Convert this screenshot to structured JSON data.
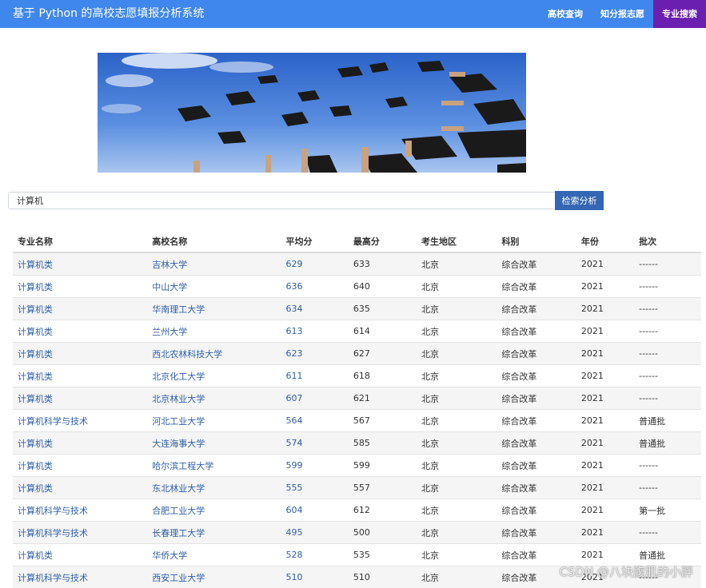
{
  "header": {
    "title": "基于 Python 的高校志愿填报分析系统",
    "nav": [
      {
        "label": "高校查询",
        "active": false
      },
      {
        "label": "知分报志愿",
        "active": false
      },
      {
        "label": "专业搜索",
        "active": true
      }
    ]
  },
  "search": {
    "value": "计算机",
    "button_label": "检索分析"
  },
  "table": {
    "columns": [
      "专业名称",
      "高校名称",
      "平均分",
      "最高分",
      "考生地区",
      "科别",
      "年份",
      "批次"
    ],
    "rows": [
      [
        "计算机类",
        "吉林大学",
        "629",
        "633",
        "北京",
        "综合改革",
        "2021",
        "------"
      ],
      [
        "计算机类",
        "中山大学",
        "636",
        "640",
        "北京",
        "综合改革",
        "2021",
        "------"
      ],
      [
        "计算机类",
        "华南理工大学",
        "634",
        "635",
        "北京",
        "综合改革",
        "2021",
        "------"
      ],
      [
        "计算机类",
        "兰州大学",
        "613",
        "614",
        "北京",
        "综合改革",
        "2021",
        "------"
      ],
      [
        "计算机类",
        "西北农林科技大学",
        "623",
        "627",
        "北京",
        "综合改革",
        "2021",
        "------"
      ],
      [
        "计算机类",
        "北京化工大学",
        "611",
        "618",
        "北京",
        "综合改革",
        "2021",
        "------"
      ],
      [
        "计算机类",
        "北京林业大学",
        "607",
        "621",
        "北京",
        "综合改革",
        "2021",
        "------"
      ],
      [
        "计算机科学与技术",
        "河北工业大学",
        "564",
        "567",
        "北京",
        "综合改革",
        "2021",
        "普通批"
      ],
      [
        "计算机类",
        "大连海事大学",
        "574",
        "585",
        "北京",
        "综合改革",
        "2021",
        "普通批"
      ],
      [
        "计算机类",
        "哈尔滨工程大学",
        "599",
        "599",
        "北京",
        "综合改革",
        "2021",
        "------"
      ],
      [
        "计算机类",
        "东北林业大学",
        "555",
        "557",
        "北京",
        "综合改革",
        "2021",
        "------"
      ],
      [
        "计算机科学与技术",
        "合肥工业大学",
        "604",
        "612",
        "北京",
        "综合改革",
        "2021",
        "第一批"
      ],
      [
        "计算机科学与技术",
        "长春理工大学",
        "495",
        "500",
        "北京",
        "综合改革",
        "2021",
        "------"
      ],
      [
        "计算机类",
        "华侨大学",
        "528",
        "535",
        "北京",
        "综合改革",
        "2021",
        "普通批"
      ],
      [
        "计算机科学与技术",
        "西安工业大学",
        "510",
        "510",
        "北京",
        "综合改革",
        "2021",
        "------"
      ]
    ]
  },
  "watermark": "CSDN @八块腹肌的小胖",
  "colors": {
    "topbar": "#3f87ec",
    "active_nav": "#6a1fb0",
    "button": "#3467b3",
    "link": "#2f5fa7"
  }
}
